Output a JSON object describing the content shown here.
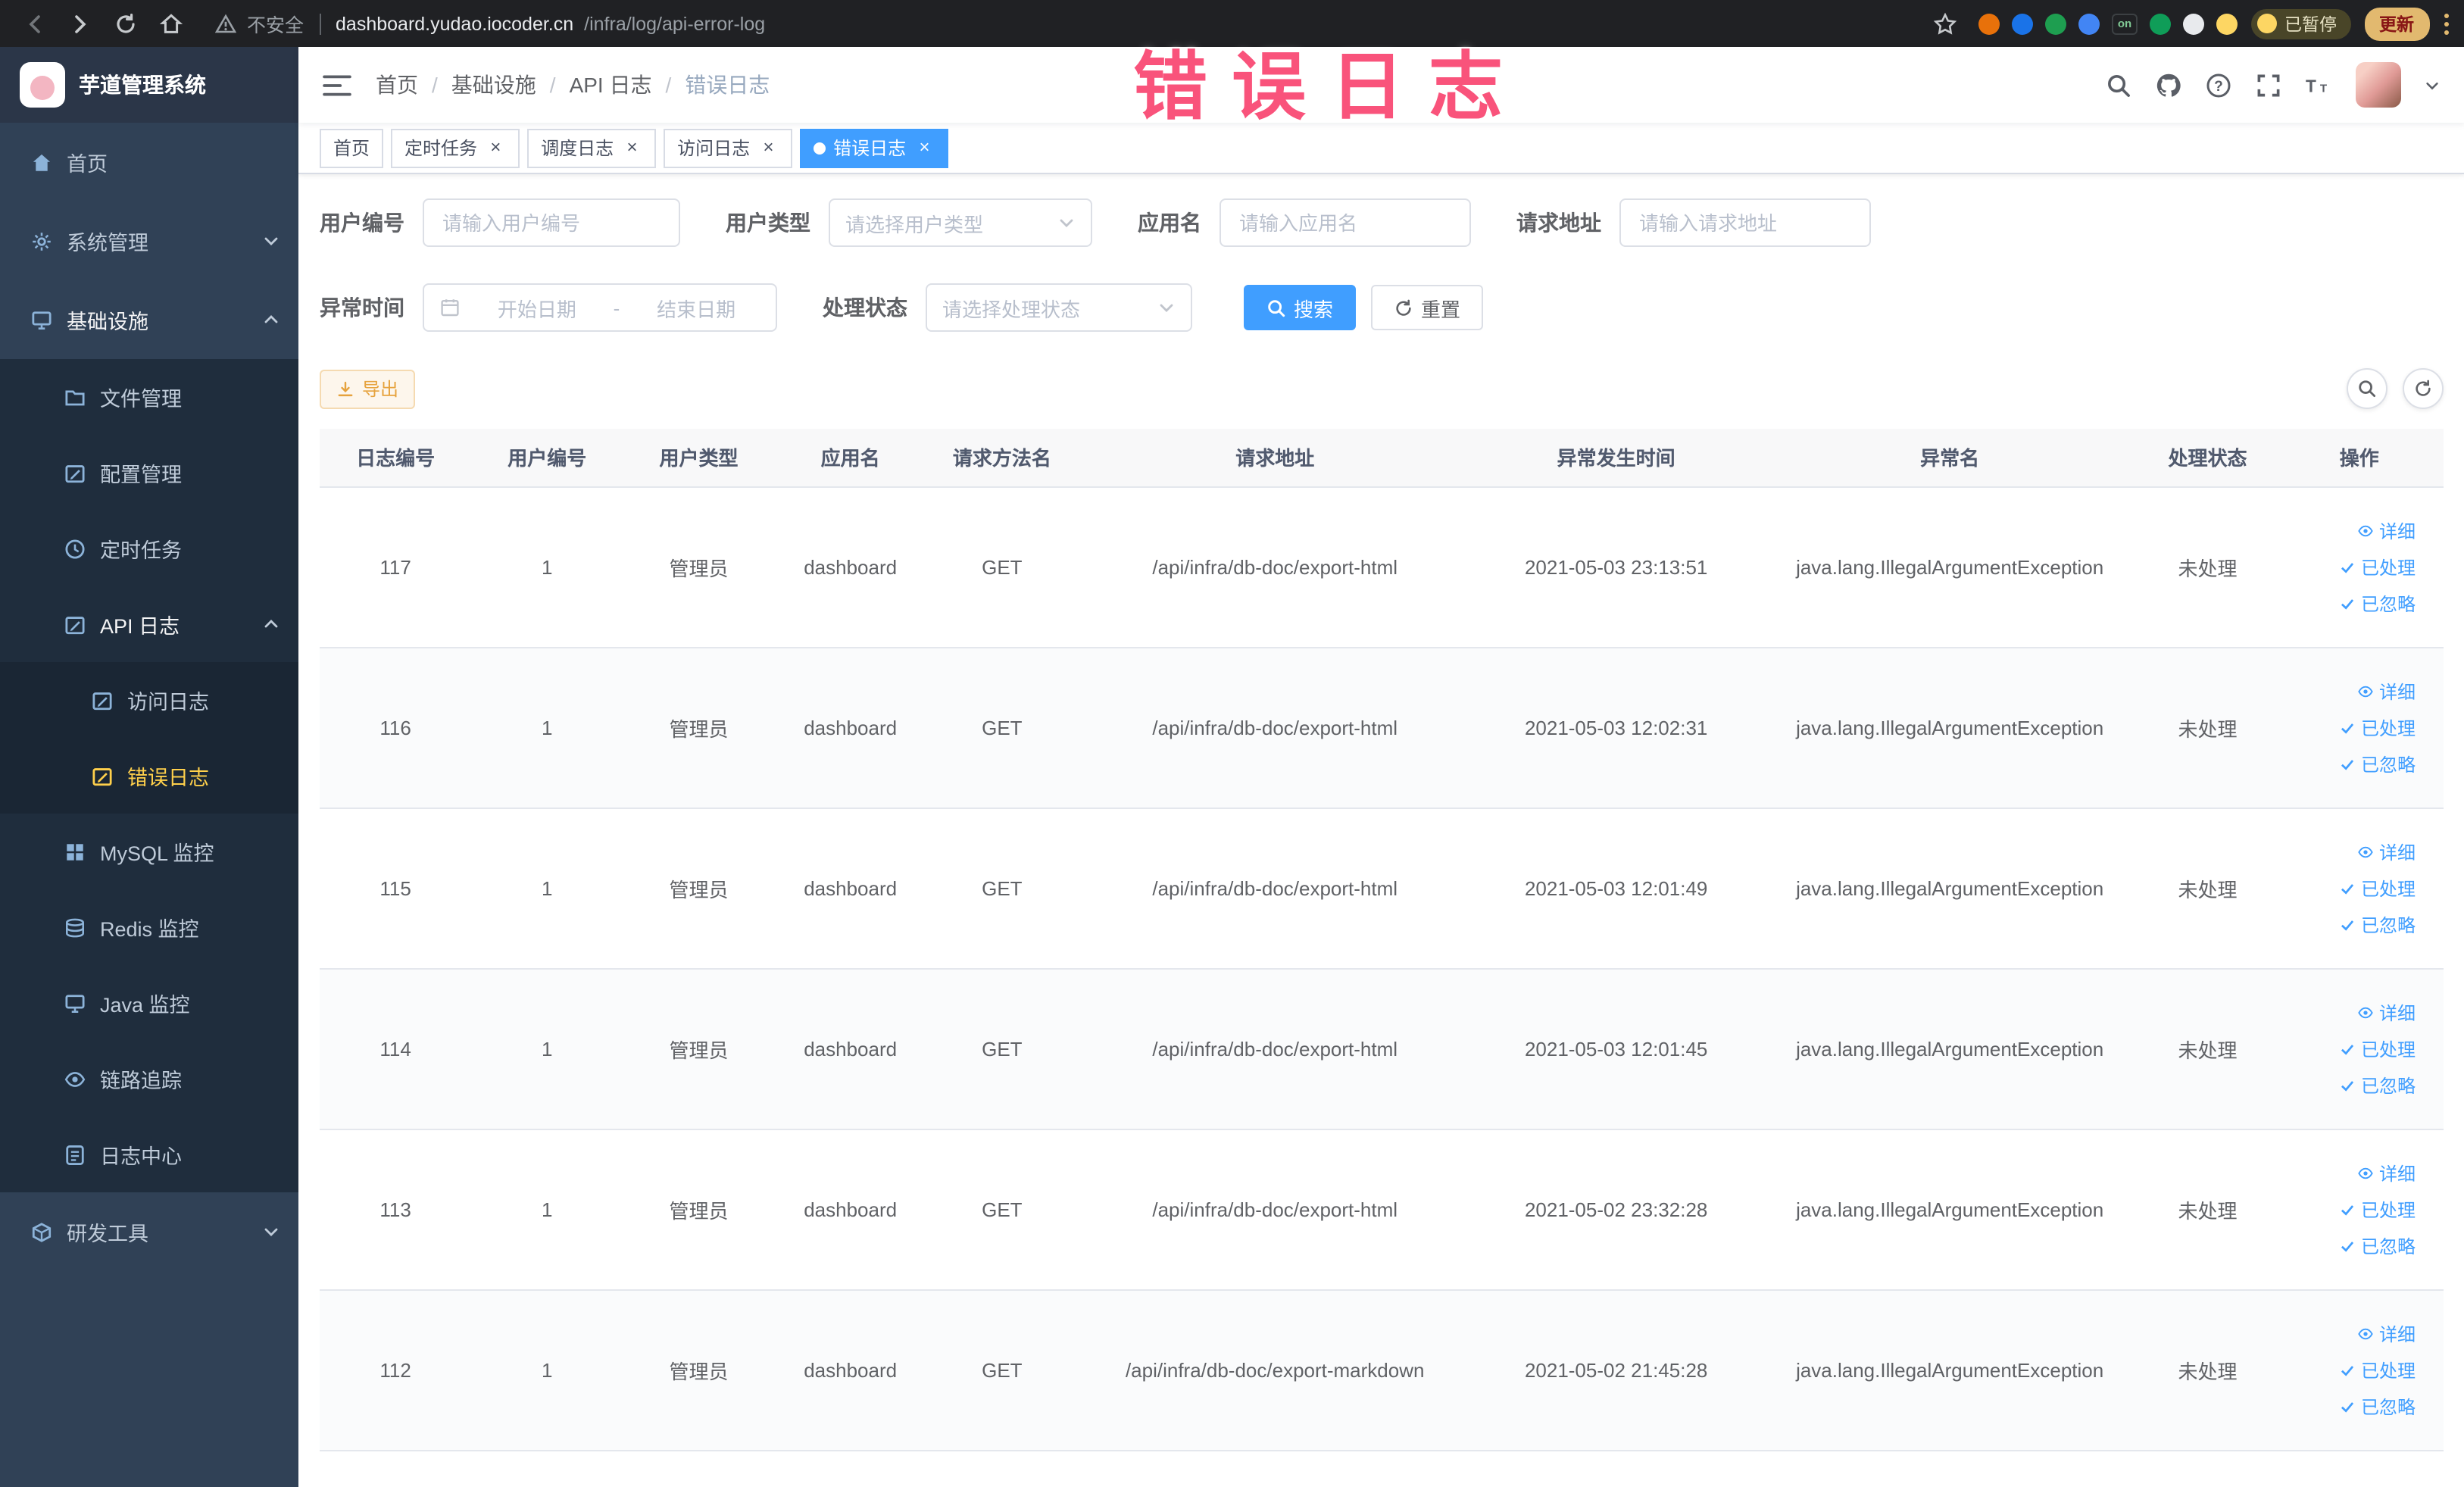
{
  "browser": {
    "security_label": "不安全",
    "url_host": "dashboard.yudao.iocoder.cn",
    "url_path": "/infra/log/api-error-log",
    "paused_label": "已暂停",
    "update_label": "更新",
    "extensions": [
      {
        "name": "ext-orange",
        "color": "#e8710a"
      },
      {
        "name": "ext-blue",
        "color": "#1a73e8"
      },
      {
        "name": "ext-green",
        "color": "#1e9e50"
      },
      {
        "name": "ext-grid",
        "color": "#4285f4"
      },
      {
        "name": "ext-on-badge",
        "color": "#202124",
        "label": "on"
      },
      {
        "name": "ext-leaf",
        "color": "#0f9d58"
      },
      {
        "name": "ext-paw",
        "color": "#e8eaed"
      },
      {
        "name": "ext-smiley",
        "color": "#fdd663"
      }
    ]
  },
  "sidebar": {
    "logo_title": "芋道管理系统",
    "items": [
      {
        "label": "首页",
        "level": 1,
        "icon": "home"
      },
      {
        "label": "系统管理",
        "level": 1,
        "icon": "gear",
        "expandable": true,
        "expanded": false
      },
      {
        "label": "基础设施",
        "level": 1,
        "icon": "screen",
        "expandable": true,
        "expanded": true
      },
      {
        "label": "文件管理",
        "level": 2,
        "icon": "folder"
      },
      {
        "label": "配置管理",
        "level": 2,
        "icon": "edit"
      },
      {
        "label": "定时任务",
        "level": 2,
        "icon": "clock"
      },
      {
        "label": "API 日志",
        "level": 2,
        "icon": "edit",
        "expandable": true,
        "expanded": true
      },
      {
        "label": "访问日志",
        "level": 3,
        "icon": "edit"
      },
      {
        "label": "错误日志",
        "level": 3,
        "icon": "edit",
        "active": true
      },
      {
        "label": "MySQL 监控",
        "level": 2,
        "icon": "grid"
      },
      {
        "label": "Redis 监控",
        "level": 2,
        "icon": "layers"
      },
      {
        "label": "Java 监控",
        "level": 2,
        "icon": "screen"
      },
      {
        "label": "链路追踪",
        "level": 2,
        "icon": "eye"
      },
      {
        "label": "日志中心",
        "level": 2,
        "icon": "doc"
      },
      {
        "label": "研发工具",
        "level": 1,
        "icon": "box",
        "expandable": true,
        "expanded": false
      }
    ]
  },
  "header": {
    "breadcrumb": [
      "首页",
      "基础设施",
      "API 日志",
      "错误日志"
    ]
  },
  "annotation": "错误日志",
  "tabs": [
    {
      "label": "首页",
      "closable": false,
      "active": false
    },
    {
      "label": "定时任务",
      "closable": true,
      "active": false
    },
    {
      "label": "调度日志",
      "closable": true,
      "active": false
    },
    {
      "label": "访问日志",
      "closable": true,
      "active": false
    },
    {
      "label": "错误日志",
      "closable": true,
      "active": true
    }
  ],
  "filters": {
    "user_id_label": "用户编号",
    "user_id_placeholder": "请输入用户编号",
    "user_type_label": "用户类型",
    "user_type_placeholder": "请选择用户类型",
    "app_name_label": "应用名",
    "app_name_placeholder": "请输入应用名",
    "request_url_label": "请求地址",
    "request_url_placeholder": "请输入请求地址",
    "exception_time_label": "异常时间",
    "start_placeholder": "开始日期",
    "range_separator": "-",
    "end_placeholder": "结束日期",
    "status_label": "处理状态",
    "status_placeholder": "请选择处理状态",
    "search_label": "搜索",
    "reset_label": "重置"
  },
  "toolbar": {
    "export_label": "导出"
  },
  "table": {
    "columns": [
      "日志编号",
      "用户编号",
      "用户类型",
      "应用名",
      "请求方法名",
      "请求地址",
      "异常发生时间",
      "异常名",
      "处理状态",
      "操作"
    ],
    "actions": [
      "详细",
      "已处理",
      "已忽略"
    ],
    "rows": [
      {
        "id": "117",
        "user_id": "1",
        "user_type": "管理员",
        "app_name": "dashboard",
        "method": "GET",
        "url": "/api/infra/db-doc/export-html",
        "time": "2021-05-03 23:13:51",
        "exception": "java.lang.IllegalArgumentException",
        "status": "未处理"
      },
      {
        "id": "116",
        "user_id": "1",
        "user_type": "管理员",
        "app_name": "dashboard",
        "method": "GET",
        "url": "/api/infra/db-doc/export-html",
        "time": "2021-05-03 12:02:31",
        "exception": "java.lang.IllegalArgumentException",
        "status": "未处理"
      },
      {
        "id": "115",
        "user_id": "1",
        "user_type": "管理员",
        "app_name": "dashboard",
        "method": "GET",
        "url": "/api/infra/db-doc/export-html",
        "time": "2021-05-03 12:01:49",
        "exception": "java.lang.IllegalArgumentException",
        "status": "未处理"
      },
      {
        "id": "114",
        "user_id": "1",
        "user_type": "管理员",
        "app_name": "dashboard",
        "method": "GET",
        "url": "/api/infra/db-doc/export-html",
        "time": "2021-05-03 12:01:45",
        "exception": "java.lang.IllegalArgumentException",
        "status": "未处理"
      },
      {
        "id": "113",
        "user_id": "1",
        "user_type": "管理员",
        "app_name": "dashboard",
        "method": "GET",
        "url": "/api/infra/db-doc/export-html",
        "time": "2021-05-02 23:32:28",
        "exception": "java.lang.IllegalArgumentException",
        "status": "未处理"
      },
      {
        "id": "112",
        "user_id": "1",
        "user_type": "管理员",
        "app_name": "dashboard",
        "method": "GET",
        "url": "/api/infra/db-doc/export-markdown",
        "time": "2021-05-02 21:45:28",
        "exception": "java.lang.IllegalArgumentException",
        "status": "未处理"
      }
    ]
  }
}
